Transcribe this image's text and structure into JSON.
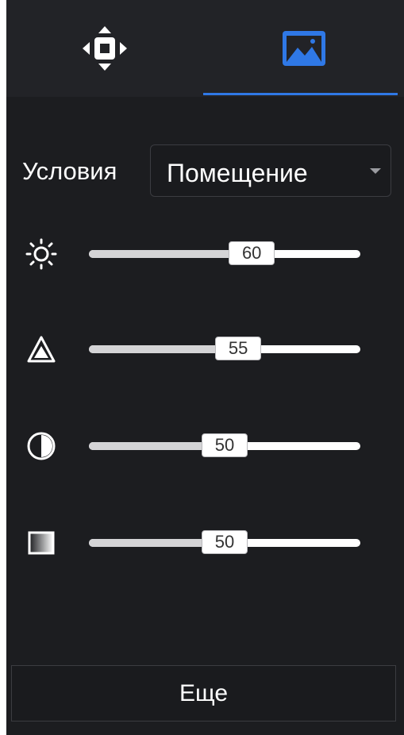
{
  "tabs": [
    {
      "icon": "ptz-direction-icon",
      "active": false
    },
    {
      "icon": "image-icon",
      "active": true
    }
  ],
  "colors": {
    "accent": "#2f78e6",
    "panel_bg": "#1c1d20",
    "tab_bar_bg": "#222327"
  },
  "conditions": {
    "label": "Условия",
    "selected": "Помещение"
  },
  "sliders": [
    {
      "icon": "brightness-icon",
      "value": "60",
      "level": 0.6
    },
    {
      "icon": "sharpness-icon",
      "value": "55",
      "level": 0.55
    },
    {
      "icon": "contrast-icon",
      "value": "50",
      "level": 0.5
    },
    {
      "icon": "saturation-icon",
      "value": "50",
      "level": 0.5
    }
  ],
  "more_button": {
    "label": "Еще"
  }
}
